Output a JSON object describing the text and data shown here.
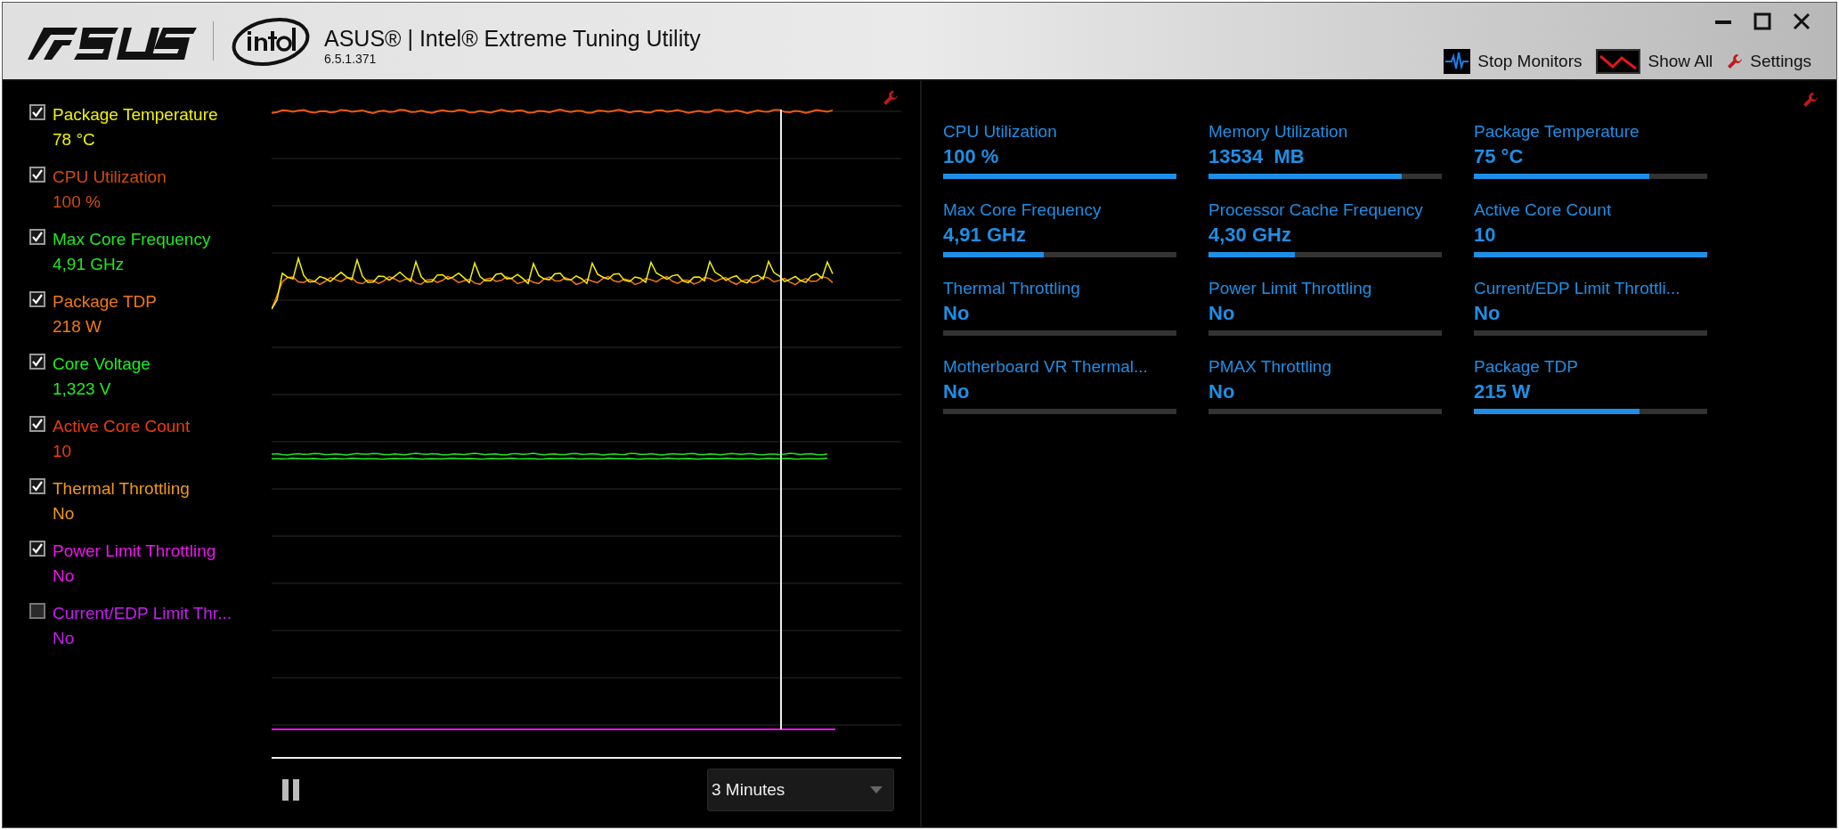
{
  "window": {
    "title": "ASUS® | Intel® Extreme Tuning Utility",
    "version": "6.5.1.371"
  },
  "toolbar": [
    {
      "kind": "monitor",
      "label": "Stop Monitors"
    },
    {
      "kind": "showall",
      "label": "Show All"
    },
    {
      "kind": "settings",
      "label": "Settings"
    }
  ],
  "legend": [
    {
      "name": "Package Temperature",
      "value": "78 °C",
      "checked": true,
      "color": "#f2f200"
    },
    {
      "name": "CPU Utilization",
      "value": "100 %",
      "checked": true,
      "color": "#d24c08"
    },
    {
      "name": "Max Core Frequency",
      "value": "4,91 GHz",
      "checked": true,
      "color": "#22e622"
    },
    {
      "name": "Package TDP",
      "value": "218 W",
      "checked": true,
      "color": "#f07812"
    },
    {
      "name": "Core Voltage",
      "value": "1,323 V",
      "checked": true,
      "color": "#1ef01e"
    },
    {
      "name": "Active Core Count",
      "value": "10",
      "checked": true,
      "color": "#f03c0a"
    },
    {
      "name": "Thermal Throttling",
      "value": "No",
      "checked": true,
      "color": "#f09a14"
    },
    {
      "name": "Power Limit Throttling",
      "value": "No",
      "checked": true,
      "color": "#f014f0"
    },
    {
      "name": "Current/EDP Limit Thr...",
      "value": "No",
      "checked": false,
      "color": "#c81ef0"
    }
  ],
  "time_range": {
    "value": "3 Minutes"
  },
  "tiles": [
    {
      "label": "CPU Utilization",
      "value": "100 %",
      "level": 1
    },
    {
      "label": "Memory Utilization",
      "value": "13534  MB",
      "level": 0.83
    },
    {
      "label": "Package Temperature",
      "value": "75 °C",
      "level": 0.75
    },
    {
      "label": "Max Core Frequency",
      "value": "4,91 GHz",
      "level": 0.43
    },
    {
      "label": "Processor Cache Frequency",
      "value": "4,30 GHz",
      "level": 0.37
    },
    {
      "label": "Active Core Count",
      "value": "10",
      "level": 1
    },
    {
      "label": "Thermal Throttling",
      "value": "No",
      "level": 0
    },
    {
      "label": "Power Limit Throttling",
      "value": "No",
      "level": 0
    },
    {
      "label": "Current/EDP Limit Throttli...",
      "value": "No",
      "level": 0
    },
    {
      "label": "Motherboard VR Thermal...",
      "value": "No",
      "level": 0
    },
    {
      "label": "PMAX Throttling",
      "value": "No",
      "level": 0
    },
    {
      "label": "Package TDP",
      "value": "215 W",
      "level": 0.71
    }
  ]
}
